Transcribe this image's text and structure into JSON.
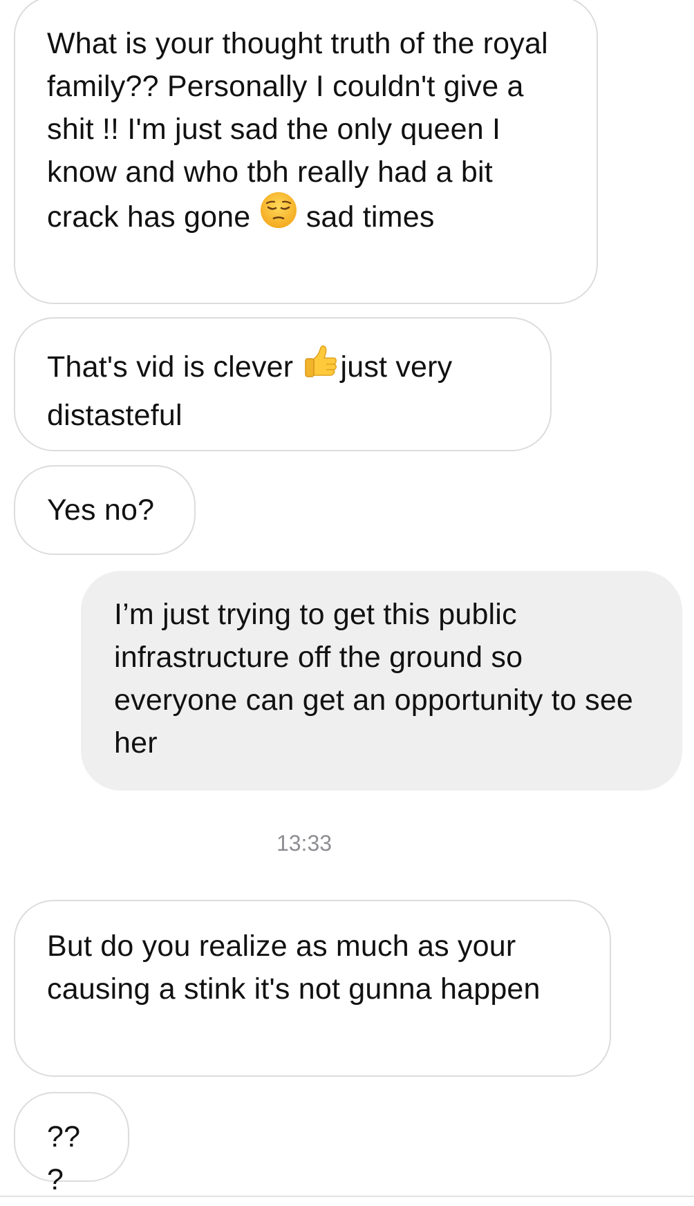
{
  "conversation": {
    "messages": [
      {
        "direction": "incoming",
        "text_before": "What is your thought truth of the royal family?? Personally I couldn't give a shit !! I'm just sad the only queen I know and who tbh really had a bit crack has gone ",
        "emoji": "pensive-face",
        "text_after": " sad times"
      },
      {
        "direction": "incoming",
        "text_before": "That's vid is clever ",
        "emoji": "thumbs-up",
        "text_after": "just very distasteful"
      },
      {
        "direction": "incoming",
        "text": "Yes no?"
      },
      {
        "direction": "outgoing",
        "text": "I’m just trying to get this public infrastructure off the ground so everyone can get an opportunity to see her"
      },
      {
        "direction": "incoming",
        "text": "But do you realize as much as your causing a stink it's not gunna happen"
      },
      {
        "direction": "incoming",
        "text": "???"
      }
    ],
    "timestamp": "13:33"
  },
  "colors": {
    "incoming_border": "#dcdcdc",
    "outgoing_background": "#efefef",
    "timestamp": "#8e8e93"
  }
}
